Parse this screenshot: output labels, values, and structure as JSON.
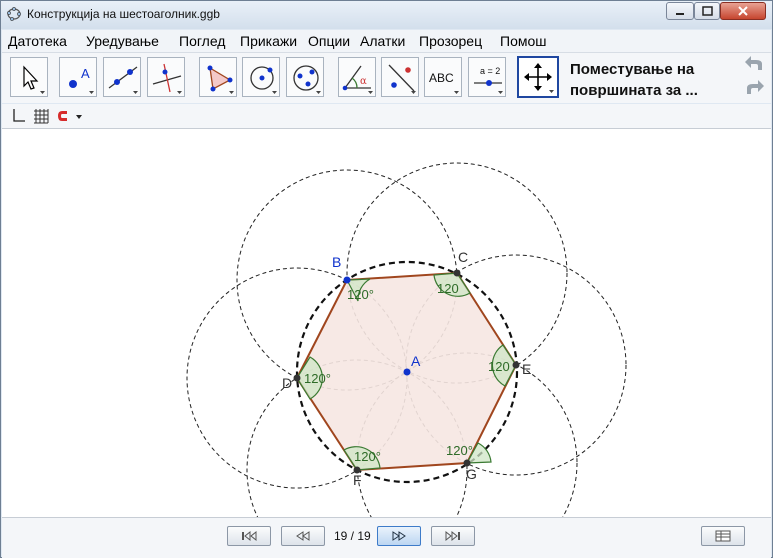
{
  "window": {
    "title": "Конструкција на шестоаголник.ggb"
  },
  "menu": {
    "items": [
      "Датотека",
      "Уредување",
      "Поглед",
      "Прикажи",
      "Опции",
      "Алатки",
      "Прозорец",
      "Помош"
    ]
  },
  "toolbar": {
    "tools": [
      {
        "name": "move-tool-icon"
      },
      {
        "name": "point-tool-icon"
      },
      {
        "name": "line-tool-icon"
      },
      {
        "name": "perpendicular-line-tool-icon"
      },
      {
        "name": "polygon-tool-icon"
      },
      {
        "name": "circle-tool-icon"
      },
      {
        "name": "conic-tool-icon"
      },
      {
        "name": "angle-tool-icon"
      },
      {
        "name": "reflect-tool-icon"
      },
      {
        "name": "text-tool-icon"
      },
      {
        "name": "slider-tool-icon"
      },
      {
        "name": "move-graphics-view-tool-icon"
      }
    ],
    "text_tool_label": "ABC",
    "slider_tool_label": "a = 2",
    "active_tool_description_line1": "Поместување на",
    "active_tool_description_line2": "површината за ..."
  },
  "construction": {
    "points": {
      "A": "A",
      "B": "B",
      "C": "C",
      "D": "D",
      "E": "E",
      "F": "F",
      "G": "G"
    },
    "angle_label": "120°",
    "angle_label_short": "120",
    "colors": {
      "polygon_edge": "#a0461e",
      "polygon_fill": "#f6e7e2",
      "angle_stroke": "#3a7a32",
      "angle_fill": "#cfe6c6",
      "point_blue": "#1033cc",
      "point_dark": "#333333"
    }
  },
  "navigation": {
    "step_counter": "19 / 19"
  }
}
